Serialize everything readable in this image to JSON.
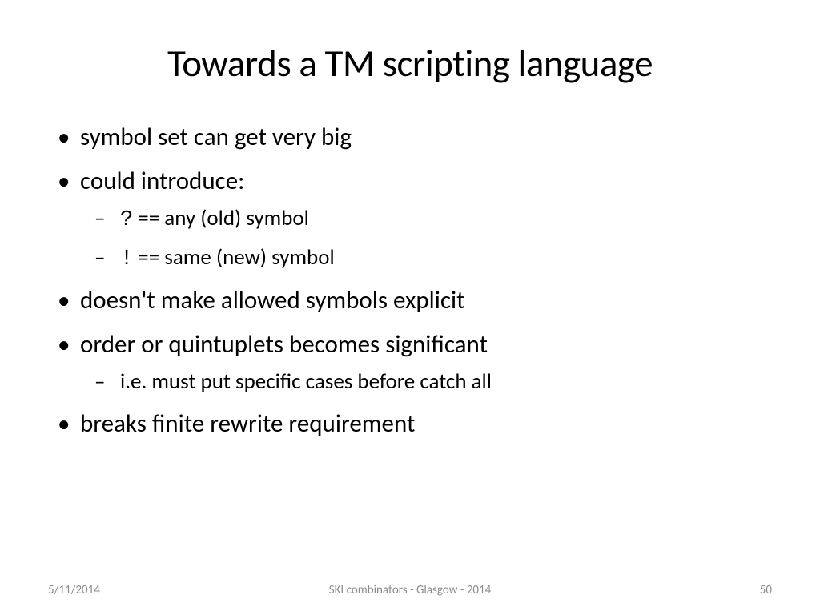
{
  "title": "Towards a TM scripting language",
  "bullets": {
    "b1": "symbol set can get very big",
    "b2": "could introduce:",
    "b2_sub1_sym": "?",
    "b2_sub1_text": " == any (old) symbol",
    "b2_sub2_sym": "!",
    "b2_sub2_text": " == same (new) symbol",
    "b3": "doesn't make allowed symbols explicit",
    "b4": "order or quintuplets becomes significant",
    "b4_sub1": "i.e. must put specific cases before catch all",
    "b5": "breaks finite rewrite requirement"
  },
  "footer": {
    "date": "5/11/2014",
    "center": "SKI combinators - Glasgow - 2014",
    "page": "50"
  }
}
